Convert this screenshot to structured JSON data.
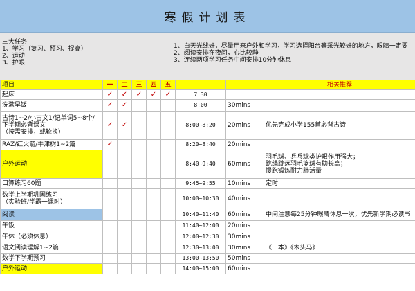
{
  "title": "寒假计划表",
  "tasks_text": "三大任务\n1、学习（复习、预习、提高）\n2、运动\n3、护眼",
  "notes_text": "1、白天光线好，尽量用来户外和学习，学习选择阳台等采光较好的地方，眼睛一定要\n2、阅读安排在夜间，心比较静\n3、连续两项学习任务中间安排10分钟休息",
  "table": {
    "headers": {
      "item": "项目",
      "days": [
        "一",
        "二",
        "三",
        "四",
        "五"
      ],
      "time": "",
      "duration": "",
      "rec": "相关推荐"
    },
    "rows": [
      {
        "item": "起床",
        "checks": [
          "✓",
          "✓",
          "✓",
          "✓",
          "✓"
        ],
        "time": "7:30",
        "duration": "",
        "rec": ""
      },
      {
        "item": "洗漱早饭",
        "checks": [
          "✓",
          "✓",
          "",
          "",
          ""
        ],
        "time": "8:00",
        "duration": "30mins",
        "rec": ""
      },
      {
        "item": "古诗1~2/小古文1/记单词5~8个/\n下学期必背课文\n（按需安排，或轮换）",
        "checks": [
          "✓",
          "✓",
          "",
          "",
          ""
        ],
        "time": "8:00~8:20",
        "duration": "20mins",
        "rec": "优先完成小学155首必背古诗"
      },
      {
        "item": "RAZ/红火箭/牛津树1~2篇",
        "checks": [
          "✓",
          "",
          "",
          "",
          ""
        ],
        "time": "8:20~8:40",
        "duration": "20mins",
        "rec": ""
      },
      {
        "item": "户外运动",
        "checks": [
          "",
          "",
          "",
          "",
          ""
        ],
        "time": "8:40~9:40",
        "duration": "60mins",
        "rec": "羽毛球、乒乓球类护眼作用强大；\n跳绳跳远羽毛篮球有助长高；\n慢跑锻炼耐力肺活量"
      },
      {
        "item": "口算练习60题",
        "checks": [
          "",
          "",
          "",
          "",
          ""
        ],
        "time": "9:45~9:55",
        "duration": "10mins",
        "rec": "定时"
      },
      {
        "item": "数学上学期巩固练习\n（实验班/学霸一课时）",
        "checks": [
          "",
          "",
          "",
          "",
          ""
        ],
        "time": "10:00~10:30",
        "duration": "40mins",
        "rec": ""
      },
      {
        "item": "阅读",
        "checks": [
          "",
          "",
          "",
          "",
          ""
        ],
        "time": "10:40~11:40",
        "duration": "60mins",
        "rec": "中间注意每25分钟眼睛休息一次，优先新学期必读书"
      },
      {
        "item": "午饭",
        "checks": [
          "",
          "",
          "",
          "",
          ""
        ],
        "time": "11:40~12:00",
        "duration": "20mins",
        "rec": ""
      },
      {
        "item": "午休（必须休息）",
        "checks": [
          "",
          "",
          "",
          "",
          ""
        ],
        "time": "12:00~12:30",
        "duration": "30mins",
        "rec": ""
      },
      {
        "item": "语文阅读理解1~2篇",
        "checks": [
          "",
          "",
          "",
          "",
          ""
        ],
        "time": "12:30~13:00",
        "duration": "30mins",
        "rec": "《一本》《木头马》"
      },
      {
        "item": "数学下学期预习",
        "checks": [
          "",
          "",
          "",
          "",
          ""
        ],
        "time": "13:00~13:50",
        "duration": "50mins",
        "rec": ""
      },
      {
        "item": "户外运动",
        "checks": [
          "",
          "",
          "",
          "",
          ""
        ],
        "time": "14:00~15:00",
        "duration": "60mins",
        "rec": ""
      }
    ]
  },
  "colors": {
    "title_bg": "#9dc3e6",
    "info_bg": "#e7e6e6",
    "highlight_yellow": "#ffff00",
    "highlight_blue": "#9dc3e6",
    "check": "#c00000"
  }
}
